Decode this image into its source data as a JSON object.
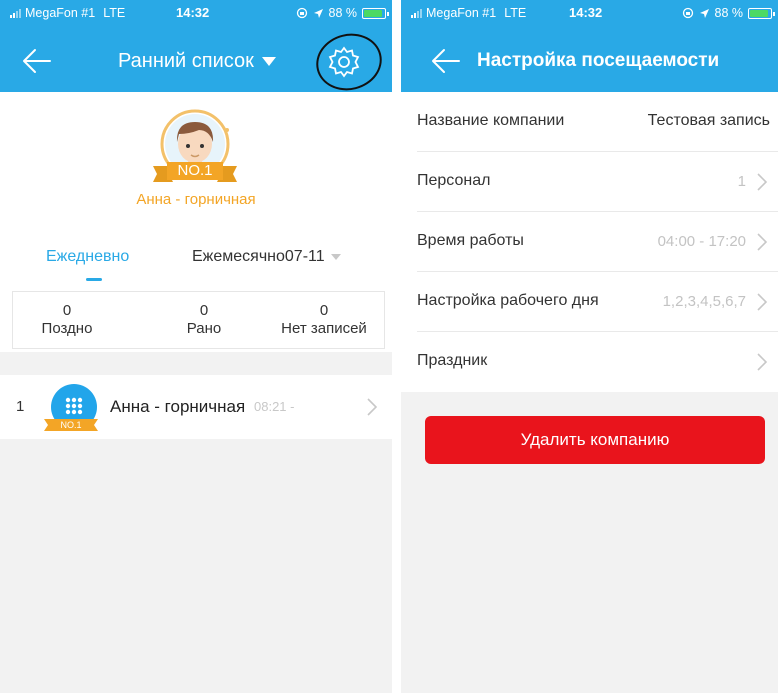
{
  "status_left": {
    "carrier": "MegaFon #1",
    "network": "LTE",
    "time": "14:32",
    "battery": "88 %",
    "battery_level": 0.88
  },
  "status_right": {
    "carrier": "MegaFon #1",
    "network": "LTE",
    "time": "14:32",
    "battery": "88 %",
    "battery_level": 0.88
  },
  "left": {
    "title": "Ранний список",
    "top_employee": {
      "badge": "NO.1",
      "name": "Анна - горничная"
    },
    "tabs": {
      "daily": "Ежедневно",
      "monthly": "Ежемесячно",
      "month_value": "07-11"
    },
    "stats": [
      {
        "value": "0",
        "label": "Поздно"
      },
      {
        "value": "0",
        "label": "Рано"
      },
      {
        "value": "0",
        "label": "Нет записей"
      }
    ],
    "entry": {
      "rank": "1",
      "badge": "NO.1",
      "name": "Анна - горничная",
      "time": "08:21 -"
    }
  },
  "right": {
    "title": "Настройка посещаемости",
    "rows": [
      {
        "label": "Название компании",
        "value": "Тестовая запись"
      },
      {
        "label": "Персонал",
        "value": "1"
      },
      {
        "label": "Время работы",
        "value": "04:00 - 17:20"
      },
      {
        "label": "Настройка рабочего дня",
        "value": "1,2,3,4,5,6,7"
      },
      {
        "label": "Праздник",
        "value": ""
      }
    ],
    "delete_button": "Удалить компанию"
  },
  "colors": {
    "primary": "#29a9e6",
    "accent_gold": "#f3a526",
    "danger": "#e9141c",
    "background": "#f2f2f2"
  },
  "icons": [
    "signal-icon",
    "location-icon",
    "rotation-lock-icon",
    "battery-icon",
    "back-arrow-icon",
    "dropdown-triangle-icon",
    "settings-gear-icon",
    "avatar-icon",
    "grid-dots-icon",
    "chevron-right-icon"
  ]
}
